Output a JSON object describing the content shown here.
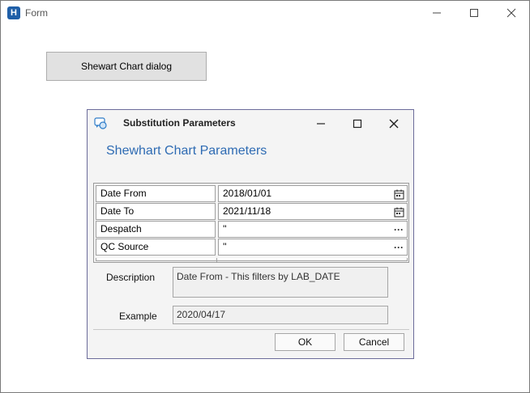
{
  "window": {
    "title": "Form",
    "icon": "app-logo-icon"
  },
  "main": {
    "open_button_label": "Shewart Chart dialog"
  },
  "dialog": {
    "title": "Substitution Parameters",
    "heading": "Shewhart Chart Parameters",
    "parameters": [
      {
        "name": "Date From",
        "value": "2018/01/01",
        "icon": "calendar-icon"
      },
      {
        "name": "Date To",
        "value": "2021/11/18",
        "icon": "calendar-icon"
      },
      {
        "name": "Despatch",
        "value": "''",
        "icon": "ellipsis-icon"
      },
      {
        "name": "QC Source",
        "value": "''",
        "icon": "ellipsis-icon"
      }
    ],
    "description_label": "Description",
    "description_value": "Date From - This filters by LAB_DATE",
    "example_label": "Example",
    "example_value": "2020/04/17",
    "ok_label": "OK",
    "cancel_label": "Cancel"
  },
  "colors": {
    "heading": "#2e6bb3",
    "app_icon": "#1f5fa8"
  }
}
